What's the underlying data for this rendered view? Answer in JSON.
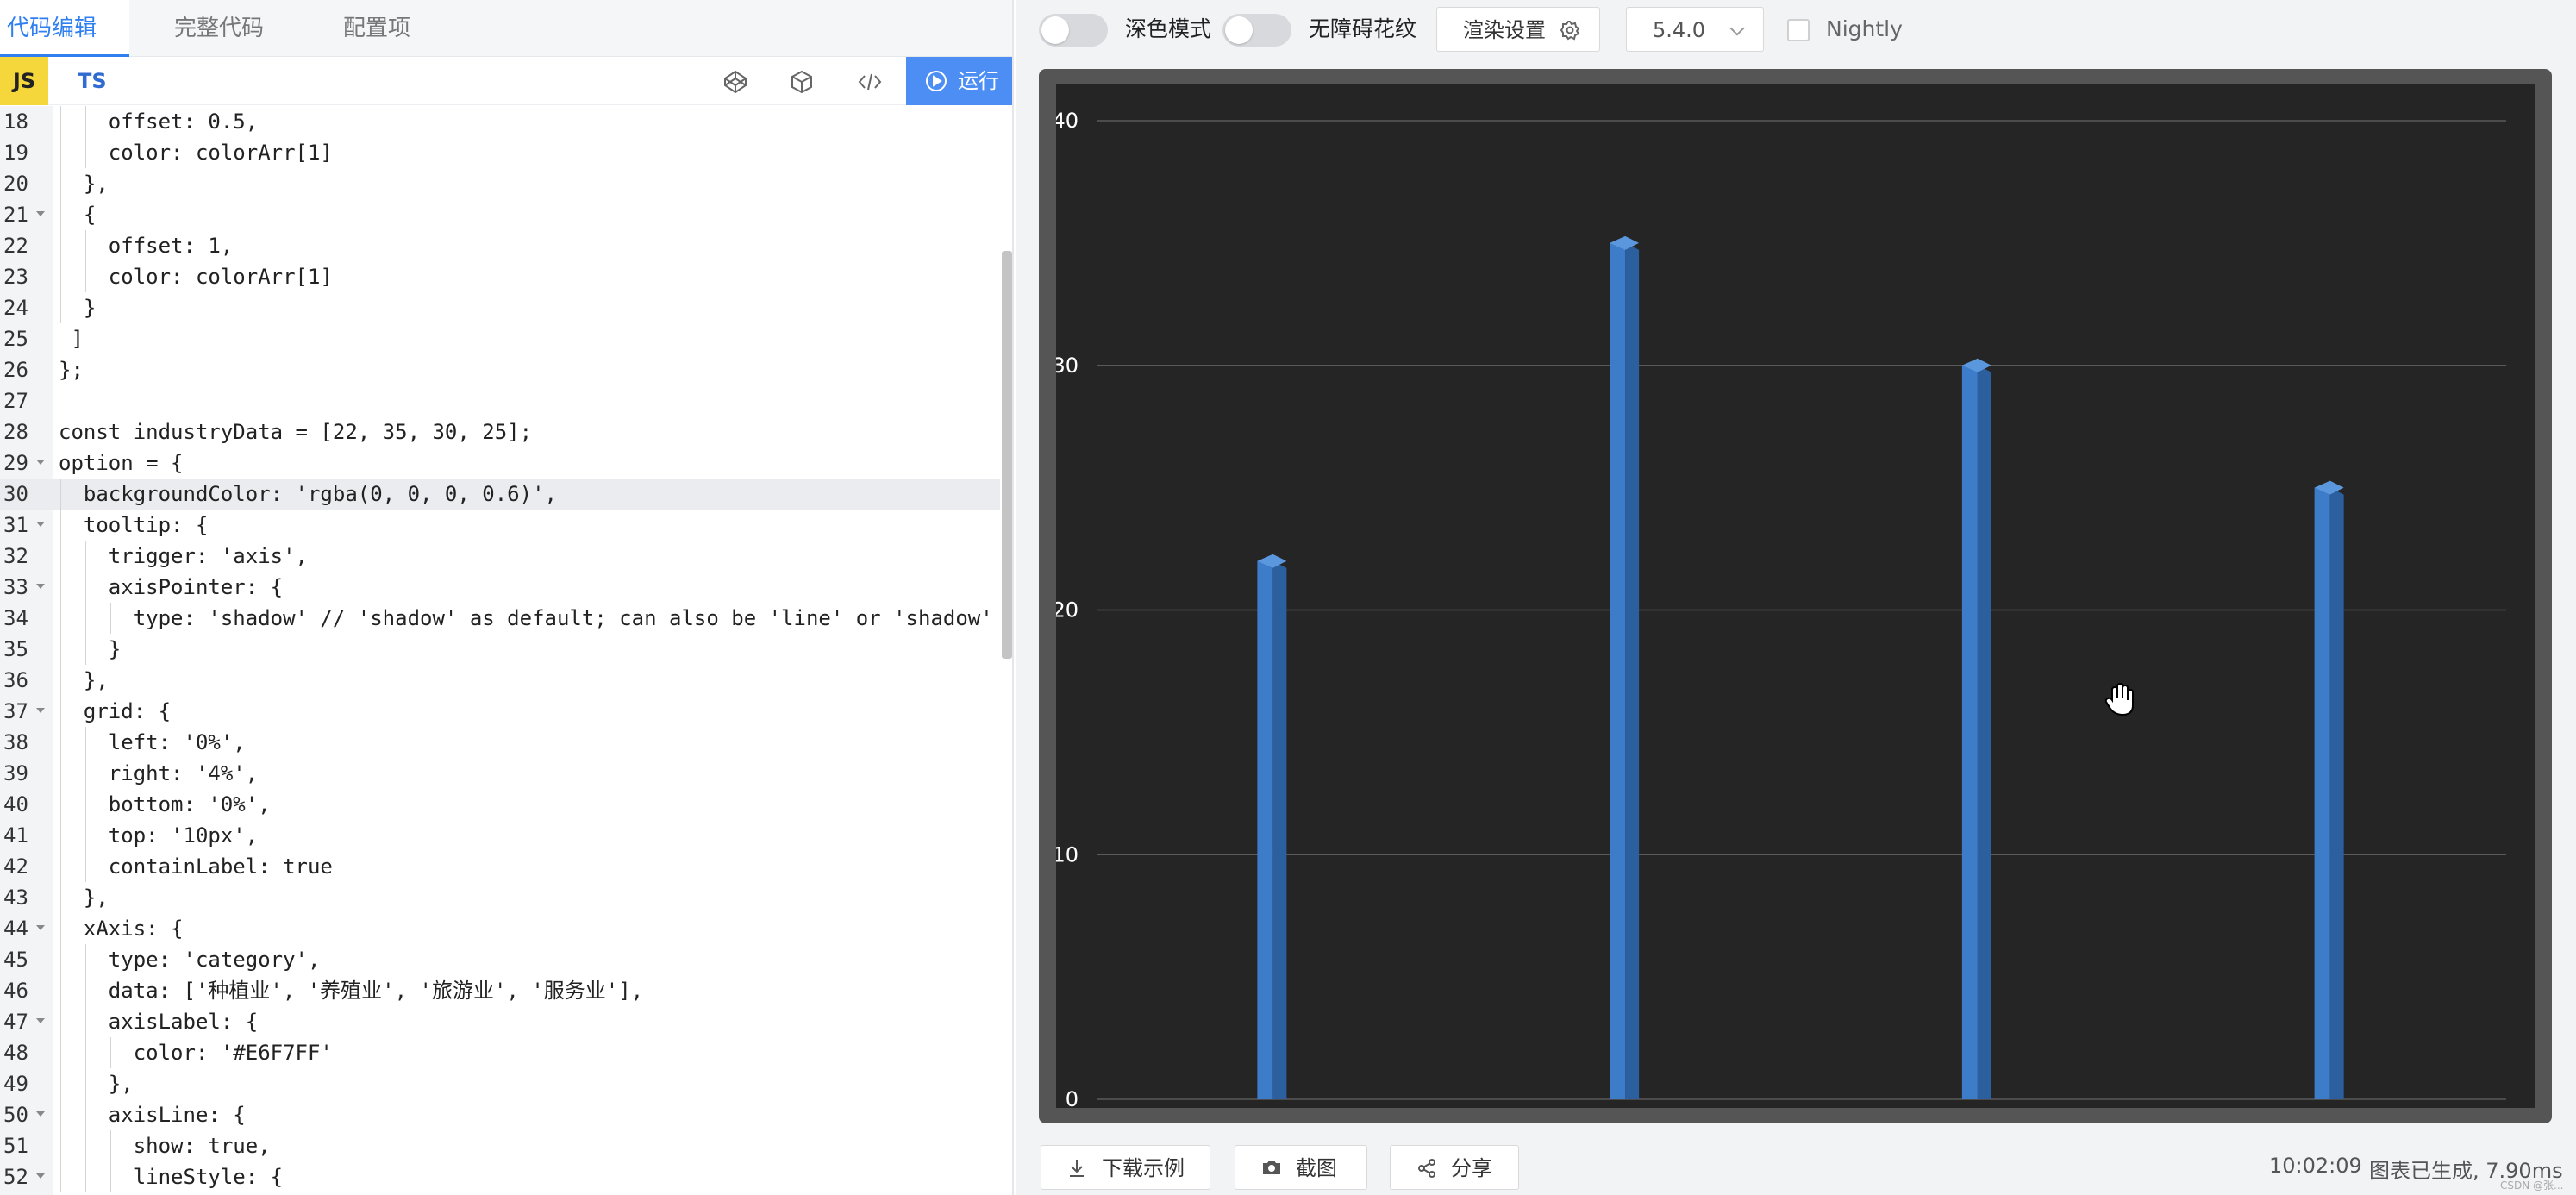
{
  "left_panel": {
    "tabs": [
      {
        "label": "代码编辑"
      },
      {
        "label": "完整代码"
      },
      {
        "label": "配置项"
      }
    ],
    "lang": {
      "js": "JS",
      "ts": "TS"
    },
    "run_label": "运行",
    "code_lines": [
      {
        "n": "18",
        "fold": false,
        "text": "    offset: 0.5,"
      },
      {
        "n": "19",
        "fold": false,
        "text": "    color: colorArr[1]"
      },
      {
        "n": "20",
        "fold": false,
        "text": "  },"
      },
      {
        "n": "21",
        "fold": true,
        "text": "  {"
      },
      {
        "n": "22",
        "fold": false,
        "text": "    offset: 1,"
      },
      {
        "n": "23",
        "fold": false,
        "text": "    color: colorArr[1]"
      },
      {
        "n": "24",
        "fold": false,
        "text": "  }"
      },
      {
        "n": "25",
        "fold": false,
        "text": " ]"
      },
      {
        "n": "26",
        "fold": false,
        "text": "};"
      },
      {
        "n": "27",
        "fold": false,
        "text": ""
      },
      {
        "n": "28",
        "fold": false,
        "text": "const industryData = [22, 35, 30, 25];"
      },
      {
        "n": "29",
        "fold": true,
        "text": "option = {"
      },
      {
        "n": "30",
        "fold": false,
        "text": "  backgroundColor: 'rgba(0, 0, 0, 0.6)',"
      },
      {
        "n": "31",
        "fold": true,
        "text": "  tooltip: {"
      },
      {
        "n": "32",
        "fold": false,
        "text": "    trigger: 'axis',"
      },
      {
        "n": "33",
        "fold": true,
        "text": "    axisPointer: {"
      },
      {
        "n": "34",
        "fold": false,
        "text": "      type: 'shadow' // 'shadow' as default; can also be 'line' or 'shadow'"
      },
      {
        "n": "35",
        "fold": false,
        "text": "    }"
      },
      {
        "n": "36",
        "fold": false,
        "text": "  },"
      },
      {
        "n": "37",
        "fold": true,
        "text": "  grid: {"
      },
      {
        "n": "38",
        "fold": false,
        "text": "    left: '0%',"
      },
      {
        "n": "39",
        "fold": false,
        "text": "    right: '4%',"
      },
      {
        "n": "40",
        "fold": false,
        "text": "    bottom: '0%',"
      },
      {
        "n": "41",
        "fold": false,
        "text": "    top: '10px',"
      },
      {
        "n": "42",
        "fold": false,
        "text": "    containLabel: true"
      },
      {
        "n": "43",
        "fold": false,
        "text": "  },"
      },
      {
        "n": "44",
        "fold": true,
        "text": "  xAxis: {"
      },
      {
        "n": "45",
        "fold": false,
        "text": "    type: 'category',"
      },
      {
        "n": "46",
        "fold": false,
        "text": "    data: ['种植业', '养殖业', '旅游业', '服务业'],"
      },
      {
        "n": "47",
        "fold": true,
        "text": "    axisLabel: {"
      },
      {
        "n": "48",
        "fold": false,
        "text": "      color: '#E6F7FF'"
      },
      {
        "n": "49",
        "fold": false,
        "text": "    },"
      },
      {
        "n": "50",
        "fold": true,
        "text": "    axisLine: {"
      },
      {
        "n": "51",
        "fold": false,
        "text": "      show: true,"
      },
      {
        "n": "52",
        "fold": true,
        "text": "      lineStyle: {"
      }
    ],
    "highlighted_line": "30"
  },
  "right_panel": {
    "dark_mode_label": "深色模式",
    "aria_label": "无障碍花纹",
    "render_settings_label": "渲染设置",
    "version": "5.4.0",
    "nightly_label": "Nightly",
    "download_label": "下载示例",
    "screenshot_label": "截图",
    "share_label": "分享",
    "status_time": "10:02:09",
    "status_msg": "图表已生成, 7.90ms",
    "watermark": "CSDN @张..."
  },
  "colors": {
    "accent": "#2f7ff1",
    "run_button": "#4d8ef5",
    "chart_bg": "#252525",
    "bar_front": "#3d7cc9",
    "bar_side": "#2c5f9e",
    "bar_top": "#5b97dd",
    "axis_label": "#E6F7FF"
  },
  "chart_data": {
    "type": "bar",
    "categories": [
      "种植业",
      "养殖业",
      "旅游业",
      "服务业"
    ],
    "values": [
      22,
      35,
      30,
      25
    ],
    "ylim": [
      0,
      40
    ],
    "yticks": [
      "0",
      "10",
      "20",
      "30",
      "40"
    ],
    "grid": true,
    "legend": "none",
    "background": "rgba(0, 0, 0, 0.6)"
  }
}
